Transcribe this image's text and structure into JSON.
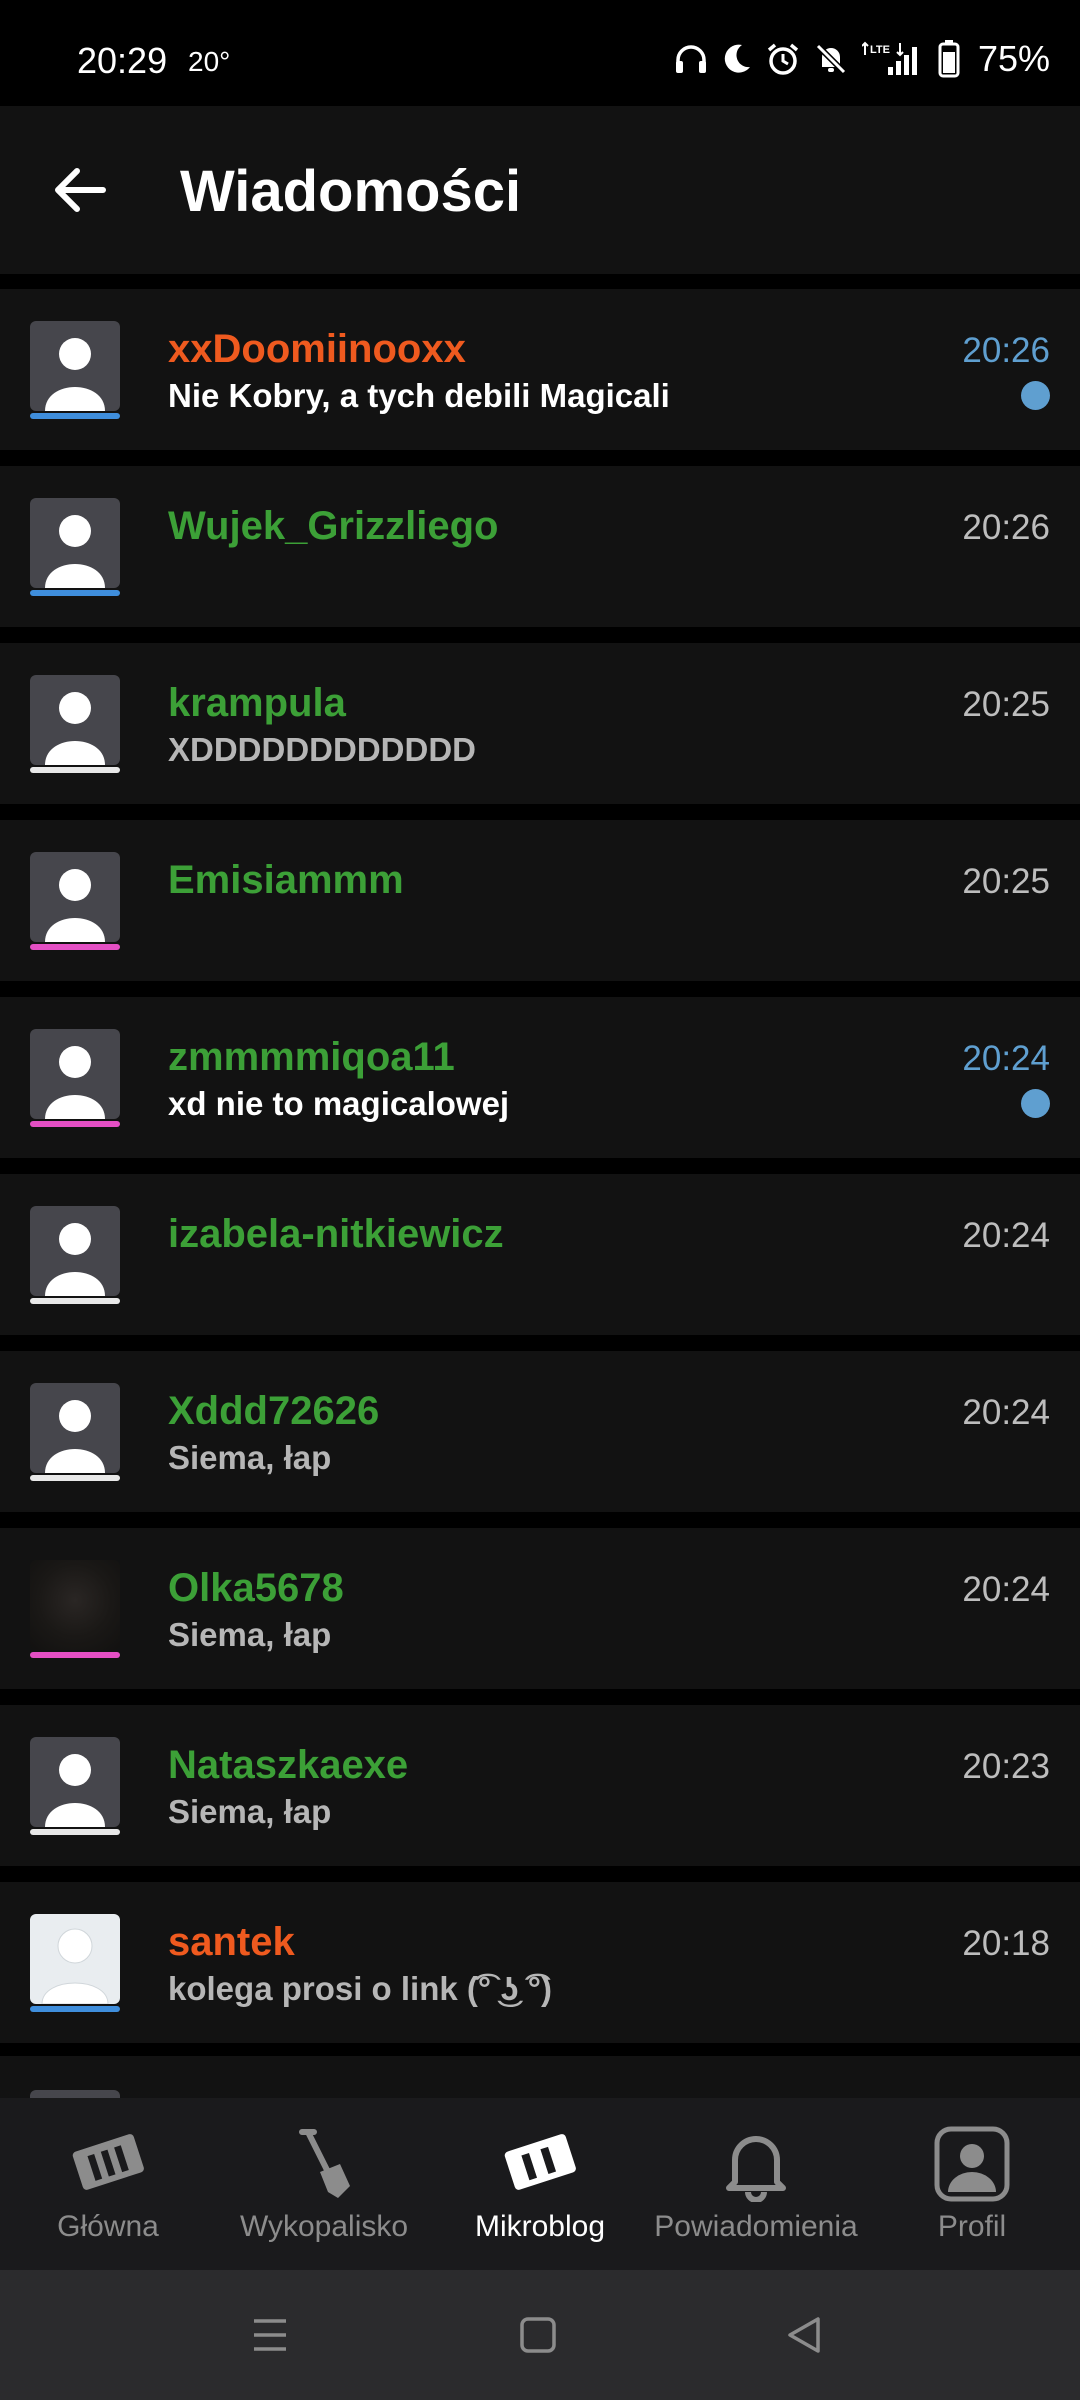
{
  "status_bar": {
    "time": "20:29",
    "temp": "20°",
    "battery": "75%",
    "icons": [
      "headphones-icon",
      "moon-icon",
      "alarm-icon",
      "mute-icon",
      "lte-signal-icon",
      "battery-icon"
    ]
  },
  "app_bar": {
    "title": "Wiadomości",
    "back_icon": "arrow-left-icon"
  },
  "colors": {
    "orange": "#ef5a1f",
    "green": "#3ca037",
    "blue": "#3f8edc",
    "pink": "#e44fc4",
    "white": "#e8e8e8",
    "unread": "#5f9fd0"
  },
  "conversations": [
    {
      "name": "xxDoomiinooxx",
      "message": "Nie Kobry, a tych debili Magicali",
      "time": "20:26",
      "unread": true,
      "name_color": "#ef5a1f",
      "bar_color": "#3f8edc",
      "avatar": "default"
    },
    {
      "name": "Wujek_Grizzliego",
      "message": "",
      "time": "20:26",
      "unread": false,
      "name_color": "#3ca037",
      "bar_color": "#3f8edc",
      "avatar": "default"
    },
    {
      "name": "krampula",
      "message": "XDDDDDDDDDDDD",
      "time": "20:25",
      "unread": false,
      "name_color": "#3ca037",
      "bar_color": "#e8e8e8",
      "avatar": "default"
    },
    {
      "name": "Emisiammm",
      "message": "",
      "time": "20:25",
      "unread": false,
      "name_color": "#3ca037",
      "bar_color": "#e44fc4",
      "avatar": "default"
    },
    {
      "name": "zmmmmiqoa11",
      "message": "xd nie to magicalowej",
      "time": "20:24",
      "unread": true,
      "name_color": "#3ca037",
      "bar_color": "#e44fc4",
      "avatar": "default"
    },
    {
      "name": "izabela-nitkiewicz",
      "message": "",
      "time": "20:24",
      "unread": false,
      "name_color": "#3ca037",
      "bar_color": "#e8e8e8",
      "avatar": "default"
    },
    {
      "name": "Xddd72626",
      "message": "Siema, łap",
      "time": "20:24",
      "unread": false,
      "name_color": "#3ca037",
      "bar_color": "#e8e8e8",
      "avatar": "default"
    },
    {
      "name": "Olka5678",
      "message": "Siema, łap",
      "time": "20:24",
      "unread": false,
      "name_color": "#3ca037",
      "bar_color": "#e44fc4",
      "avatar": "photo-dark"
    },
    {
      "name": "Nataszkaexe",
      "message": "Siema, łap",
      "time": "20:23",
      "unread": false,
      "name_color": "#3ca037",
      "bar_color": "#e8e8e8",
      "avatar": "default"
    },
    {
      "name": "santek",
      "message": "kolega prosi o link (͡° ͜ʖ ͡°)",
      "time": "20:18",
      "unread": false,
      "name_color": "#ef5a1f",
      "bar_color": "#3f8edc",
      "avatar": "light"
    }
  ],
  "bottom_nav": [
    {
      "label": "Główna",
      "icon": "wykop-logo-icon",
      "active": false
    },
    {
      "label": "Wykopalisko",
      "icon": "shovel-icon",
      "active": false
    },
    {
      "label": "Mikroblog",
      "icon": "mikroblog-icon",
      "active": true
    },
    {
      "label": "Powiadomienia",
      "icon": "bell-icon",
      "active": false
    },
    {
      "label": "Profil",
      "icon": "profile-icon",
      "active": false
    }
  ],
  "system_nav": [
    "recents-icon",
    "home-icon",
    "back-triangle-icon"
  ]
}
